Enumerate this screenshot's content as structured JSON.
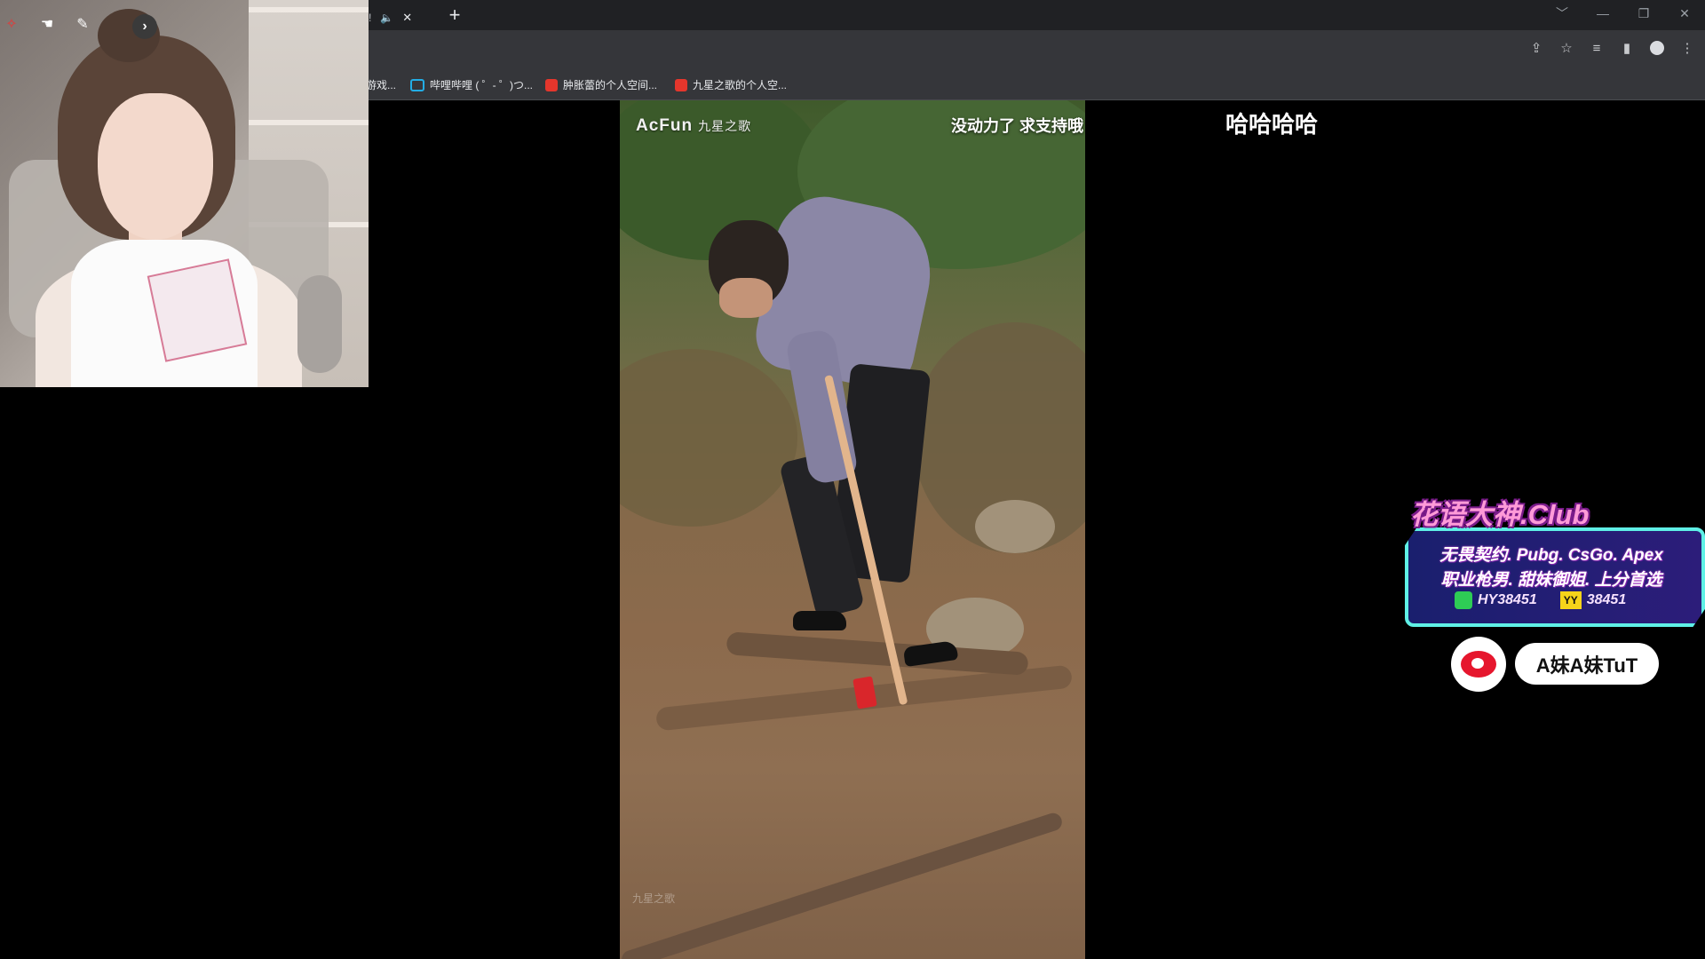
{
  "browser": {
    "tab_fragment_text": "!",
    "new_tab_symbol": "+",
    "window_controls": [
      "﹀",
      "—",
      "❐",
      "✕"
    ],
    "bookmarks": [
      {
        "label": "游戏...",
        "favicon": "none"
      },
      {
        "label": "哔哩哔哩 ( ゜- ゜)つ...",
        "favicon": "bilibili-icon"
      },
      {
        "label": "肿胀蕾的个人空间...",
        "favicon": "red-avatar-icon"
      },
      {
        "label": "九星之歌的个人空...",
        "favicon": "red-avatar-icon"
      }
    ],
    "colors": {
      "tabstrip": "#202124",
      "toolbar": "#35363a"
    }
  },
  "video": {
    "logo_text": "AcFun",
    "channel": "九星之歌",
    "caption": "没动力了 求支持哦",
    "watermark": "九星之歌"
  },
  "overlay": {
    "comment": "哈哈哈哈"
  },
  "promo": {
    "title": "花语大神.Club",
    "line1": "无畏契约. Pubg. CsGo. Apex",
    "line2": "职业枪男. 甜妹御姐. 上分首选",
    "wechat_id": "HY38451",
    "yy_label": "YY",
    "yy_id": "38451",
    "colors": {
      "border": "#5ff0e6",
      "title": "#ff9ad8"
    }
  },
  "weibo": {
    "handle": "A妹A妹TuT"
  }
}
